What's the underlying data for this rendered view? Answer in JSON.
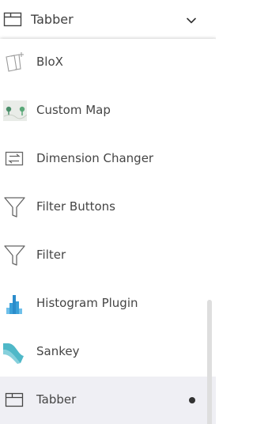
{
  "select": {
    "value": "Tabber",
    "icon": "tabber-icon"
  },
  "options": [
    {
      "label": "BloX",
      "icon": "blox-icon"
    },
    {
      "label": "Custom Map",
      "icon": "custom-map-icon"
    },
    {
      "label": "Dimension Changer",
      "icon": "dimension-changer-icon"
    },
    {
      "label": "Filter Buttons",
      "icon": "filter-buttons-icon"
    },
    {
      "label": "Filter",
      "icon": "filter-icon"
    },
    {
      "label": "Histogram Plugin",
      "icon": "histogram-icon"
    },
    {
      "label": "Sankey",
      "icon": "sankey-icon"
    },
    {
      "label": "Tabber",
      "icon": "tabber-icon",
      "selected": true
    }
  ],
  "colors": {
    "selected_row_bg": "#efeff4",
    "text": "#454545",
    "histogram_blue": "#3aa0d8",
    "sankey_teal": "#4fb8c8",
    "map_green": "#4a8f6a"
  }
}
